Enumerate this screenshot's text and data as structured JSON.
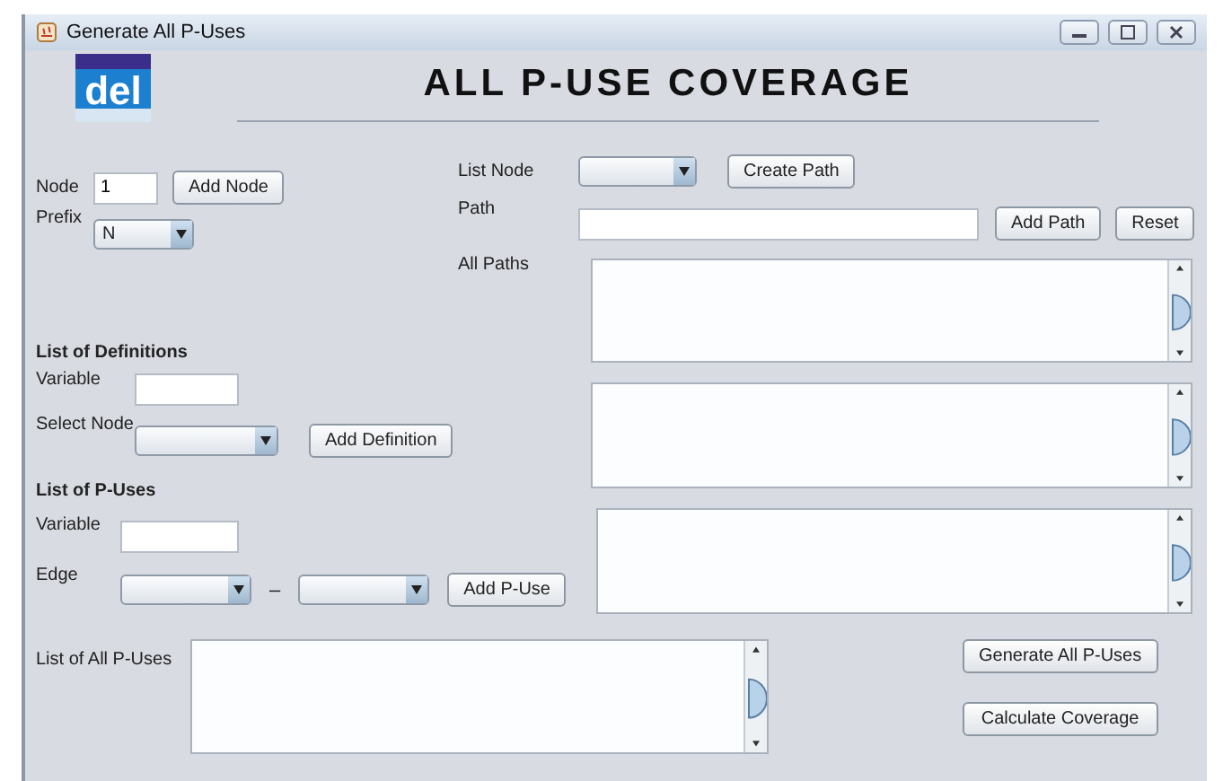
{
  "window": {
    "title": "Generate All P-Uses"
  },
  "logo": "del",
  "heading": "ALL P-USE COVERAGE",
  "node": {
    "label": "Node",
    "value": "1",
    "button": "Add Node"
  },
  "prefix": {
    "label": "Prefix",
    "value": "N"
  },
  "definitions": {
    "heading": "List of Definitions",
    "variable_label": "Variable",
    "select_label": "Select Node",
    "button": "Add Definition"
  },
  "p_uses": {
    "heading": "List of P-Uses",
    "variable_label": "Variable",
    "edge_label": "Edge",
    "separator": "–",
    "button": "Add P-Use"
  },
  "paths": {
    "list_node_label": "List Node",
    "create_button": "Create Path",
    "path_label": "Path",
    "add_button": "Add Path",
    "reset_button": "Reset",
    "all_paths_label": "All Paths"
  },
  "all_p_uses": {
    "label": "List of All P-Uses"
  },
  "buttons": [
    "Generate All P-Uses",
    "Calculate Coverage"
  ]
}
